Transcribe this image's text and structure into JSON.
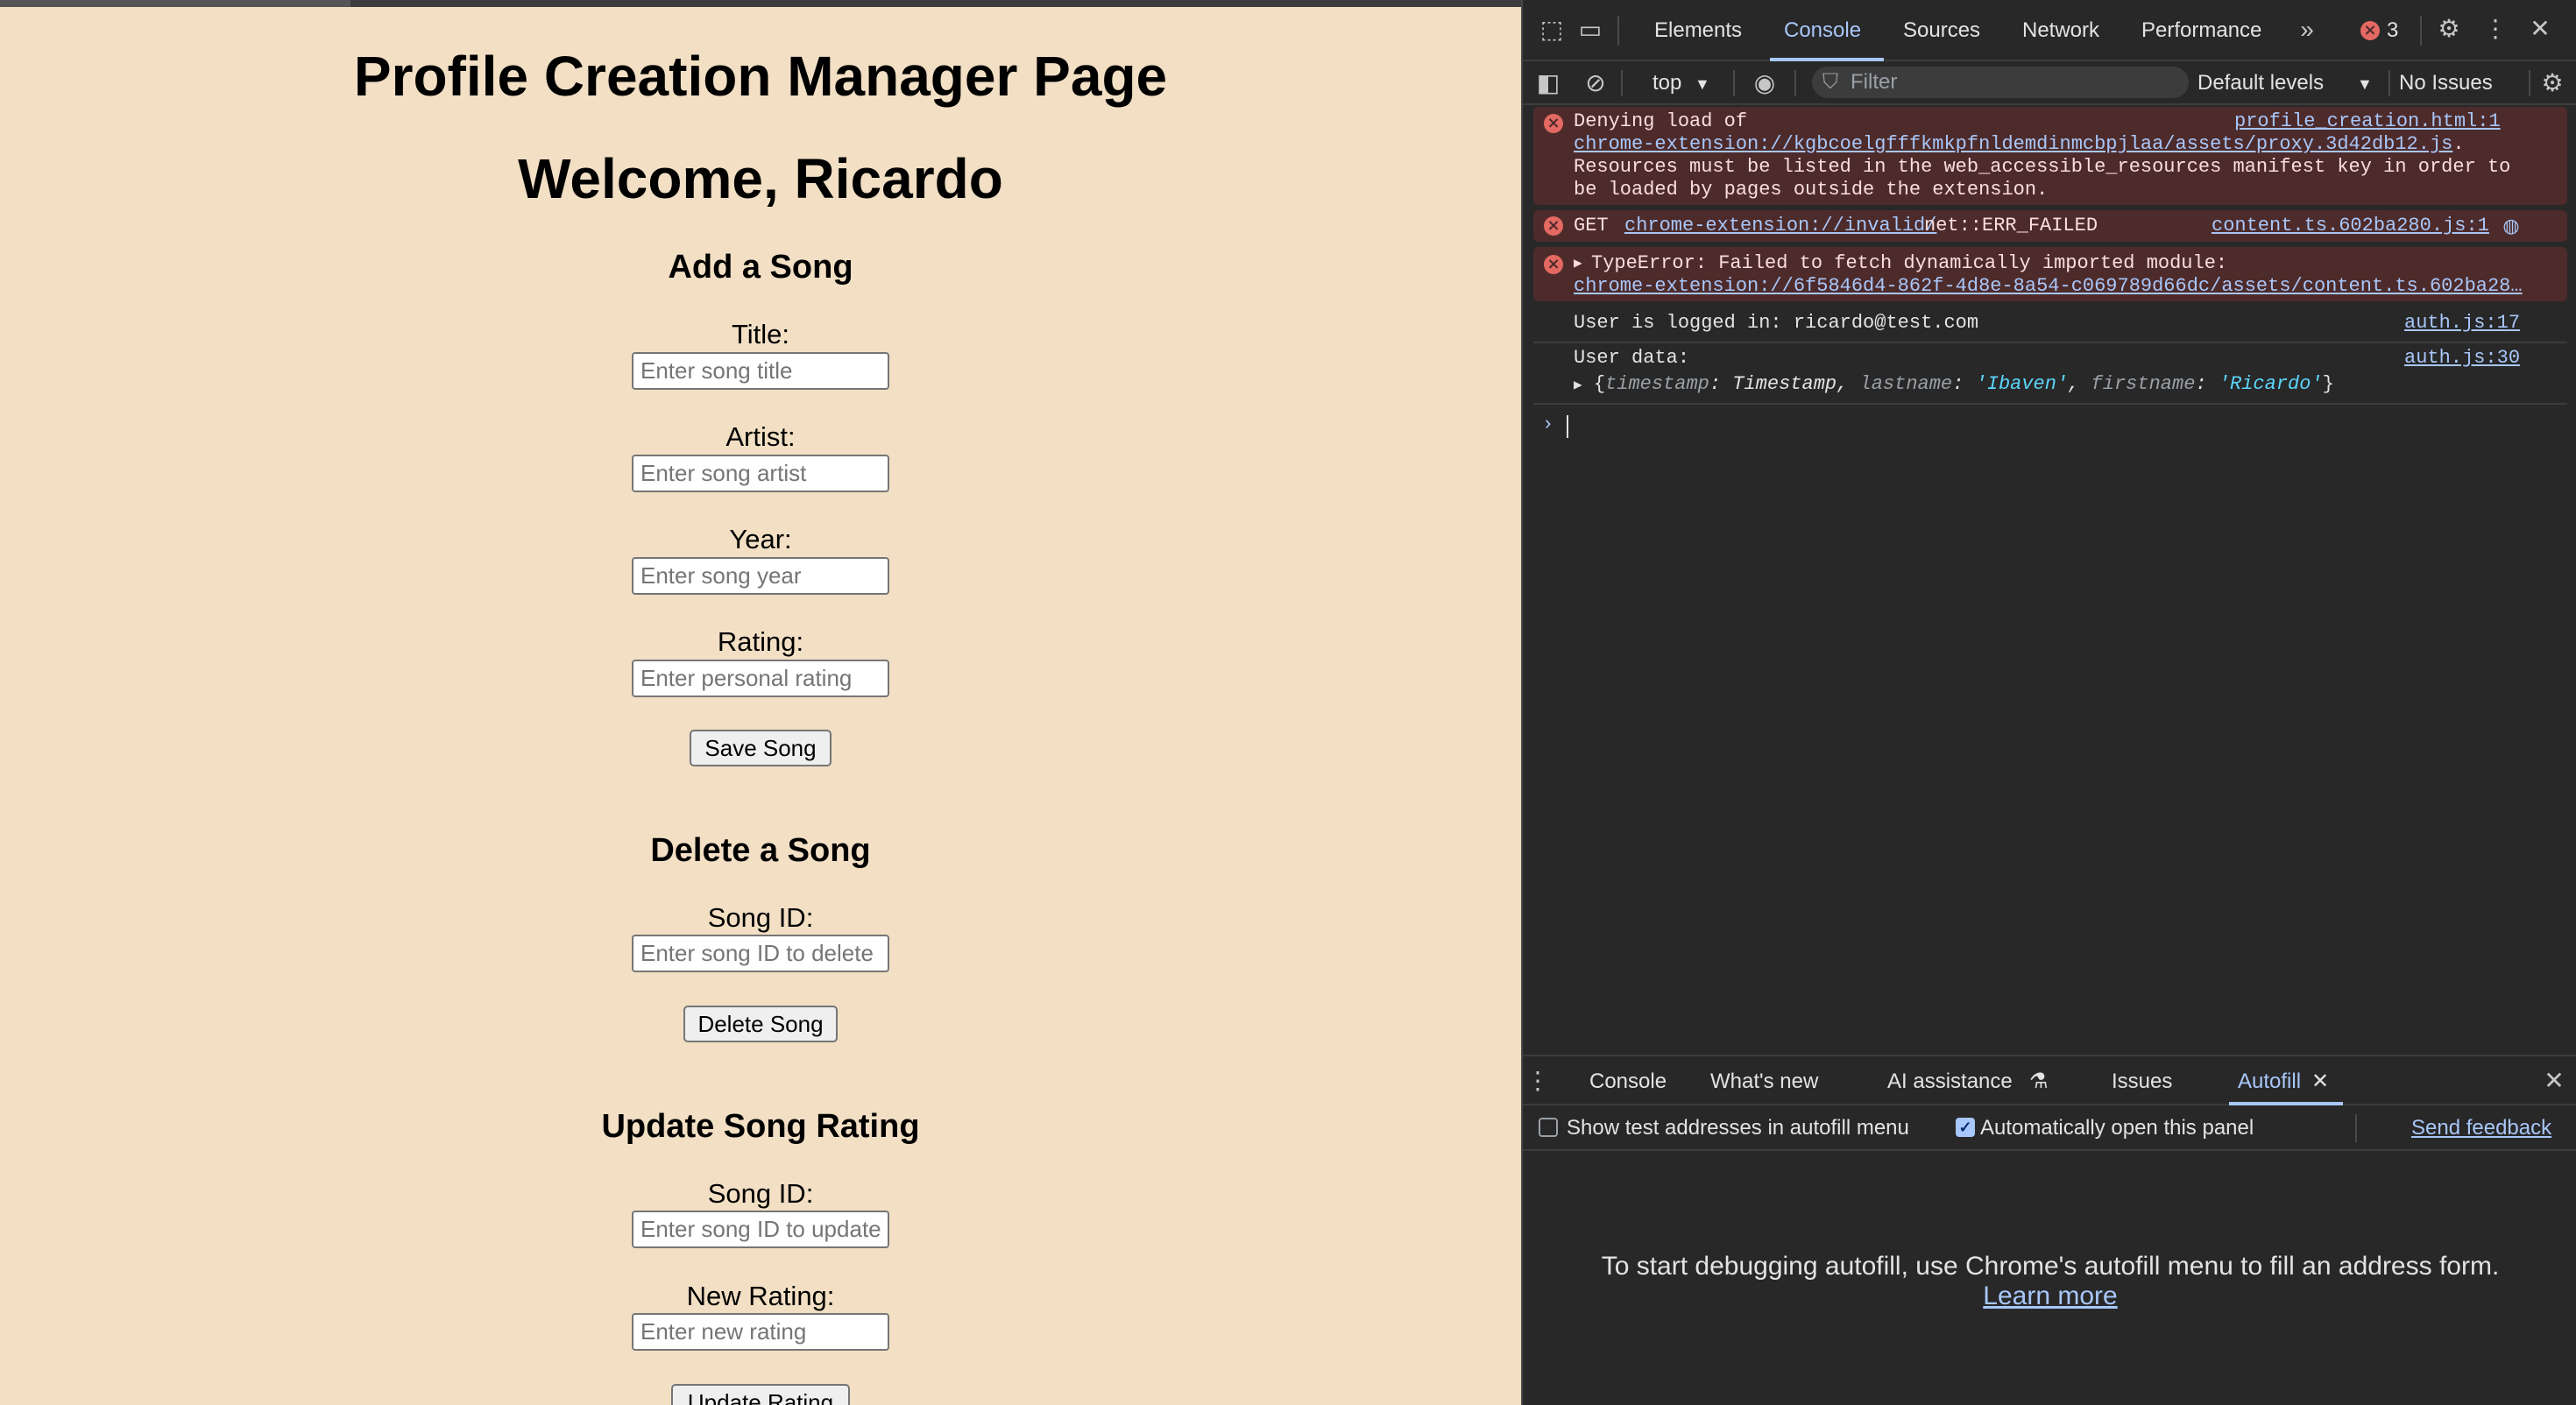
{
  "page": {
    "title": "Profile Creation Manager Page",
    "welcome": "Welcome, Ricardo",
    "add_song": {
      "heading": "Add a Song",
      "title_label": "Title:",
      "title_placeholder": "Enter song title",
      "artist_label": "Artist:",
      "artist_placeholder": "Enter song artist",
      "year_label": "Year:",
      "year_placeholder": "Enter song year",
      "rating_label": "Rating:",
      "rating_placeholder": "Enter personal rating",
      "save_button": "Save Song"
    },
    "delete_song": {
      "heading": "Delete a Song",
      "id_label": "Song ID:",
      "id_placeholder": "Enter song ID to delete",
      "delete_button": "Delete Song"
    },
    "update_rating": {
      "heading": "Update Song Rating",
      "id_label": "Song ID:",
      "id_placeholder": "Enter song ID to update",
      "rating_label": "New Rating:",
      "rating_placeholder": "Enter new rating",
      "update_button": "Update Rating"
    }
  },
  "devtools": {
    "tabs": [
      "Elements",
      "Console",
      "Sources",
      "Network",
      "Performance"
    ],
    "active_tab": "Console",
    "error_count": "3",
    "context": "top",
    "filter_placeholder": "Filter",
    "levels": "Default levels",
    "issues": "No Issues",
    "messages": {
      "m1": {
        "text1": "Denying load of",
        "link": "chrome-extension://kgbcoelgfffkmkpfnldemdinmcbpjlaa/assets/proxy.3d42db12.js",
        "link_suffix": ".",
        "text2": "Resources must be listed in the web_accessible_resources manifest key in order to",
        "text3": "be loaded by pages outside the extension.",
        "source": "profile_creation.html:1"
      },
      "m2": {
        "method": "GET",
        "link": "chrome-extension://invalid/",
        "status": "net::ERR_FAILED",
        "source": "content.ts.602ba280.js:1"
      },
      "m3": {
        "text": "TypeError: Failed to fetch dynamically imported module:",
        "link": "chrome-extension://6f5846d4-862f-4d8e-8a54-c069789d66dc/assets/content.ts.602ba28…"
      },
      "m4": {
        "text": "User is logged in: ricardo@test.com",
        "source": "auth.js:17"
      },
      "m5": {
        "text": "User data:",
        "source": "auth.js:30",
        "obj_open": "{",
        "k1": "timestamp",
        "v1": "Timestamp",
        "k2": "lastname",
        "v2": "'Ibaven'",
        "k3": "firstname",
        "v3": "'Ricardo'",
        "obj_close": "}"
      }
    },
    "drawer": {
      "tabs": [
        "Console",
        "What's new",
        "AI assistance",
        "Issues",
        "Autofill"
      ],
      "active_tab": "Autofill",
      "show_test_addresses": "Show test addresses in autofill menu",
      "auto_open": "Automatically open this panel",
      "feedback": "Send feedback",
      "empty_message": "To start debugging autofill, use Chrome's autofill menu to fill an address form.",
      "learn_more": "Learn more"
    }
  },
  "colors": {
    "page_bg": "#f2dfc4",
    "devtools_bg": "#282828",
    "accent": "#a8c7fa",
    "error_bg": "#4e2b2b",
    "error_icon": "#e46962"
  }
}
